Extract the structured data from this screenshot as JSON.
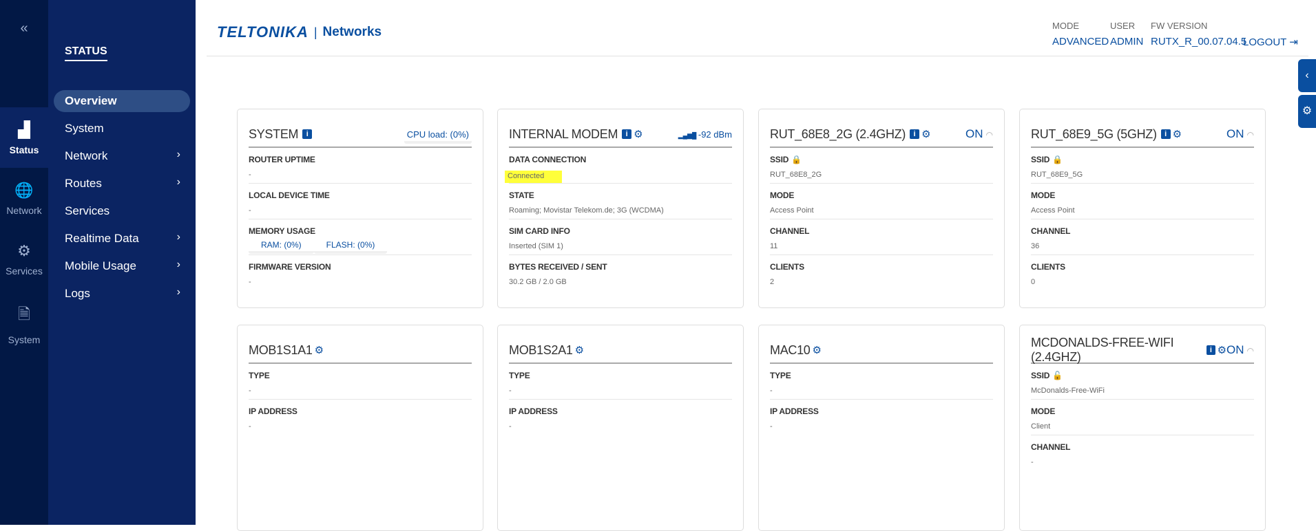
{
  "rail": {
    "collapse": "«",
    "items": [
      {
        "label": "Status",
        "icon": "signal-icon",
        "glyph": "▟",
        "active": true
      },
      {
        "label": "Network",
        "icon": "globe-icon",
        "glyph": "🌐"
      },
      {
        "label": "Services",
        "icon": "gear-icon",
        "glyph": "⚙"
      },
      {
        "label": "System",
        "icon": "file-code-icon",
        "glyph": "🗎"
      }
    ]
  },
  "nav": {
    "title": "STATUS",
    "items": [
      {
        "label": "Overview",
        "active": true
      },
      {
        "label": "System"
      },
      {
        "label": "Network",
        "sub": true
      },
      {
        "label": "Routes",
        "sub": true
      },
      {
        "label": "Services"
      },
      {
        "label": "Realtime Data",
        "sub": true
      },
      {
        "label": "Mobile Usage",
        "sub": true
      },
      {
        "label": "Logs",
        "sub": true
      }
    ]
  },
  "header": {
    "logo": "TELTONIKA",
    "logo_sub": "Networks",
    "mode_label": "MODE",
    "mode": "ADVANCED",
    "user_label": "USER",
    "user": "ADMIN",
    "fw_label": "FW VERSION",
    "fw": "RUTX_R_00.07.04.5",
    "logout": "LOGOUT"
  },
  "colors": {
    "accent": "#0a4fa0",
    "nav": "#0b2462",
    "highlight": "#ffff3a"
  },
  "cards": [
    {
      "title": "SYSTEM",
      "info": true,
      "right": "CPU load: (0%)",
      "right_type": "cpu",
      "rows": [
        {
          "label": "ROUTER UPTIME",
          "value": "-"
        },
        {
          "label": "LOCAL DEVICE TIME",
          "value": "-"
        },
        {
          "label": "MEMORY USAGE",
          "pills": [
            "RAM: (0%)",
            "FLASH: (0%)"
          ]
        },
        {
          "label": "FIRMWARE VERSION",
          "value": "-"
        }
      ]
    },
    {
      "title": "INTERNAL MODEM",
      "info": true,
      "gear": true,
      "right": "-92 dBm",
      "right_type": "signal",
      "rows": [
        {
          "label": "DATA CONNECTION",
          "value": "Connected",
          "highlight": true
        },
        {
          "label": "STATE",
          "value": "Roaming; Movistar Telekom.de; 3G (WCDMA)"
        },
        {
          "label": "SIM CARD INFO",
          "value": "Inserted (SIM 1)"
        },
        {
          "label": "BYTES RECEIVED / SENT",
          "value": "30.2 GB / 2.0 GB"
        }
      ]
    },
    {
      "title": "RUT_68E8_2G (2.4GHZ)",
      "info": true,
      "gear": true,
      "right": "ON",
      "right_type": "on",
      "rows": [
        {
          "label": "SSID",
          "lock": true,
          "value": "RUT_68E8_2G"
        },
        {
          "label": "MODE",
          "value": "Access Point"
        },
        {
          "label": "CHANNEL",
          "value": "11"
        },
        {
          "label": "CLIENTS",
          "value": "2"
        }
      ]
    },
    {
      "title": "RUT_68E9_5G (5GHZ)",
      "info": true,
      "gear": true,
      "right": "ON",
      "right_type": "on",
      "rows": [
        {
          "label": "SSID",
          "lock": true,
          "value": "RUT_68E9_5G"
        },
        {
          "label": "MODE",
          "value": "Access Point"
        },
        {
          "label": "CHANNEL",
          "value": "36"
        },
        {
          "label": "CLIENTS",
          "value": "0"
        }
      ]
    },
    {
      "title": "MOB1S1A1",
      "gear": true,
      "rows": [
        {
          "label": "TYPE",
          "value": "-"
        },
        {
          "label": "IP ADDRESS",
          "value": "-"
        }
      ]
    },
    {
      "title": "MOB1S2A1",
      "gear": true,
      "rows": [
        {
          "label": "TYPE",
          "value": "-"
        },
        {
          "label": "IP ADDRESS",
          "value": "-"
        }
      ]
    },
    {
      "title": "MAC10",
      "gear": true,
      "rows": [
        {
          "label": "TYPE",
          "value": "-"
        },
        {
          "label": "IP ADDRESS",
          "value": "-"
        }
      ]
    },
    {
      "title": "MCDONALDS-FREE-WIFI (2.4GHZ)",
      "info": true,
      "gear": true,
      "right": "ON",
      "right_type": "on",
      "rows": [
        {
          "label": "SSID",
          "lock": true,
          "unlocked": true,
          "value": "McDonalds-Free-WiFi"
        },
        {
          "label": "MODE",
          "value": "Client"
        },
        {
          "label": "CHANNEL",
          "value": "-"
        }
      ]
    }
  ]
}
